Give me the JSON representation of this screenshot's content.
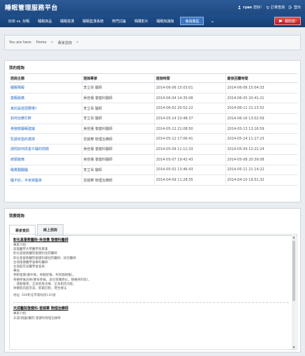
{
  "header": {
    "site_title": "睡眠管理服務平台",
    "user_name": "ryan",
    "user_suffix": "您好!",
    "order_link": "訂單查詢",
    "logout_link": "登出"
  },
  "nav": {
    "items": [
      "好床 vs. 好眠",
      "睡眠商品",
      "睡眠檢測",
      "睡眠監測系統",
      "熱門討論",
      "相關影片",
      "睡眠知識館",
      "會員專區"
    ],
    "active_index": 7,
    "logout_button": "關閉案!"
  },
  "breadcrumb": {
    "prefix": "You are here:",
    "items": [
      "Home",
      "專家諮詢"
    ],
    "separator": ">"
  },
  "consultations": {
    "title": "我的諮詢",
    "columns": [
      "諮詢主題",
      "諮詢專家",
      "諮詢時間",
      "最後回覆時間"
    ],
    "rows": [
      [
        "睡眠障礙",
        "李立昂 醫師",
        "2014-06-06 15:03:01",
        "2014-06-06 15:04:33"
      ],
      [
        "莫眠劇痛",
        "吳佳儒 復健科醫師",
        "2014-06-04 14:35:08",
        "2014-06-05 20:41:21"
      ],
      [
        "真的是枕頭要嗎？",
        "李立昂 醫師",
        "2014-06-02 20:52:22",
        "2014-06-11 21:13:52"
      ],
      [
        "如何治療打鼾",
        "李立昂 醫師",
        "2014-05-14 10:48:37",
        "2014-06-16 13:02:59"
      ],
      [
        "骨骼救睡眠建議",
        "吳佳儒 復健科醫師",
        "2014-05-12 21:08:50",
        "2014-05-13 13:16:59"
      ],
      [
        "乳膠床墊的選擇",
        "曾娟華 物理治療師",
        "2014-05-12 17:06:41",
        "2014-05-14 11:17:23"
      ],
      [
        "請問如何改善午睡的問題",
        "吳佳儒 復健科醫師",
        "2014-05-09 11:11:33",
        "2014-05-09 12:22:24"
      ],
      [
        "肩頸痠痛",
        "吳佳儒 復健科醫師",
        "2014-05-07 19:42:43",
        "2014-05-08 20:39:08"
      ],
      [
        "睡覺翻翻腦",
        "李立昂 醫師",
        "2014-05-02 13:46:43",
        "2014-05-11 21:14:22"
      ],
      [
        "睡不好，半夜常醒來",
        "曾娟華 物理治療師",
        "2014-04-09 11:28:35",
        "2014-04-10 19:51:32"
      ]
    ]
  },
  "experts": {
    "title": "我要諮詢",
    "tabs": [
      "專家資訊",
      "線上諮詢"
    ],
    "active_tab": 0,
    "entries": [
      {
        "name": "彰化基督教醫院-吳佳儒 復健科醫師",
        "lines": [
          "專家介紹:",
          "高雄醫學大學醫學系畢業",
          "彰化基督教醫院復健科住院醫師",
          "彰化基督教醫院復健科總住院醫師、研究醫師",
          "台灣復健醫學會專科醫師",
          "台灣超音波醫學會會員",
          "專長:",
          "神經復健(腦中風，脊髓受傷，失智腦損傷)，",
          "骨骼疼痛治療(腰背疼痛，退化性關節炎，頸椎骨刺等)，",
          "、運動傷害，全身肌骨治療、全身肌肉功能，",
          "骨骼肌肉超音波，肌電診斷，增生療法"
        ],
        "address": "地址: 500彰化市南校街135號"
      },
      {
        "name": "天成醫院復健科-曾娟華 物理治療師",
        "lines": [
          "專家介紹:",
          "天成(桃園)醫院 復健科物理治療師"
        ],
        "address": ""
      }
    ]
  }
}
